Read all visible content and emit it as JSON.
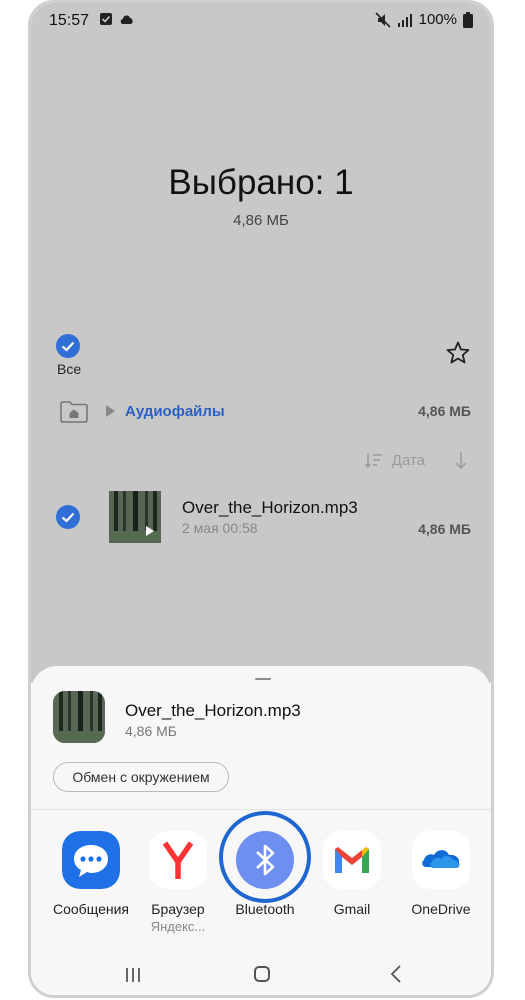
{
  "status_bar": {
    "time": "15:57",
    "battery": "100%"
  },
  "header": {
    "title": "Выбрано: 1",
    "subtitle": "4,86 МБ"
  },
  "select_all": {
    "label": "Все"
  },
  "breadcrumb": {
    "folder": "Аудиофайлы",
    "size": "4,86 МБ"
  },
  "sort": {
    "label": "Дата"
  },
  "file_row": {
    "name": "Over_the_Horizon.mp3",
    "date": "2 мая 00:58",
    "size": "4,86 МБ"
  },
  "share_sheet": {
    "file_name": "Over_the_Horizon.mp3",
    "file_size": "4,86 МБ",
    "nearby_button": "Обмен с окружением",
    "apps": [
      {
        "label": "Сообщения",
        "sublabel": ""
      },
      {
        "label": "Браузер",
        "sublabel": "Яндекс..."
      },
      {
        "label": "Bluetooth",
        "sublabel": ""
      },
      {
        "label": "Gmail",
        "sublabel": ""
      },
      {
        "label": "OneDrive",
        "sublabel": ""
      }
    ]
  },
  "colors": {
    "accent": "#2f6fd6",
    "highlight_ring": "#1e66d0",
    "overlay": "#c8c8c8"
  },
  "icons": [
    "check-icon",
    "star-icon",
    "home-folder-icon",
    "sort-icon",
    "sort-down-icon",
    "play-icon",
    "messages-icon",
    "yandex-icon",
    "bluetooth-icon",
    "gmail-icon",
    "onedrive-icon",
    "nav-recent-icon",
    "nav-home-icon",
    "nav-back-icon"
  ]
}
